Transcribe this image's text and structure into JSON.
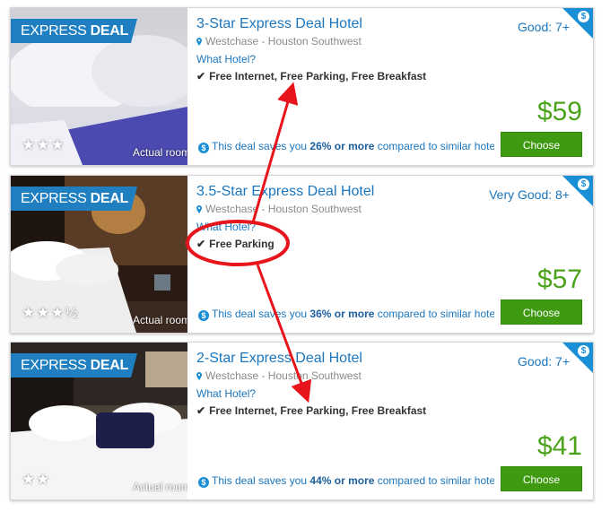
{
  "express_badge": {
    "prefix": "EXPRESS ",
    "bold": "DEAL"
  },
  "actual_room_label": "Actual room",
  "what_hotel_label": "What Hotel?",
  "choose_label": "Choose",
  "savings_prefix": "This deal saves you ",
  "savings_suffix": " compared to similar hotels",
  "colors": {
    "accent": "#1b76bd",
    "price": "#4aa31b",
    "button": "#3f9a12",
    "annotation": "#e8141b"
  },
  "hotels": [
    {
      "title": "3-Star Express Deal Hotel",
      "location": "Westchase - Houston Southwest",
      "amenities": "Free Internet, Free Parking, Free Breakfast",
      "rating": "Good: 7+",
      "price": "$59",
      "savings": "26% or more",
      "stars": "★★★"
    },
    {
      "title": "3.5-Star Express Deal Hotel",
      "location": "Westchase - Houston Southwest",
      "amenities": "Free Parking",
      "rating": "Very Good: 8+",
      "price": "$57",
      "savings": "36% or more",
      "stars": "★★★½"
    },
    {
      "title": "2-Star Express Deal Hotel",
      "location": "Westchase - Houston Southwest",
      "amenities": "Free Internet, Free Parking, Free Breakfast",
      "rating": "Good: 7+",
      "price": "$41",
      "savings": "44% or more",
      "stars": "★★"
    }
  ]
}
